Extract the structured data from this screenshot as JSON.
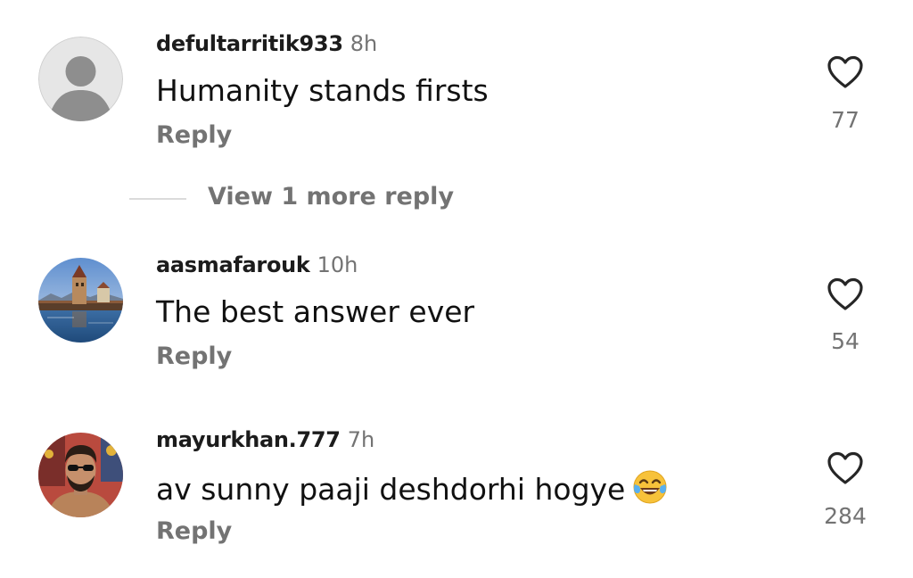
{
  "comments": [
    {
      "username": "defultarritik933",
      "time": "8h",
      "text": "Humanity stands firsts",
      "reply_label": "Reply",
      "likes": "77",
      "avatar": "default-avatar-icon"
    },
    {
      "username": "aasmafarouk",
      "time": "10h",
      "text": "The best answer ever",
      "reply_label": "Reply",
      "likes": "54",
      "avatar": "bridge-tower-photo"
    },
    {
      "username": "mayurkhan.777",
      "time": "7h",
      "text": "av sunny paaji deshdorhi hogye",
      "emoji": "face-with-tears-of-joy",
      "reply_label": "Reply",
      "likes": "284",
      "avatar": "man-with-sunglasses-photo"
    }
  ],
  "view_more_replies": "View 1 more reply",
  "colors": {
    "text": "#111111",
    "secondary": "#737373",
    "divider": "#dbdbdb",
    "default_avatar_bg": "#d9d9d9",
    "default_avatar_fg": "#8e8e8e"
  }
}
